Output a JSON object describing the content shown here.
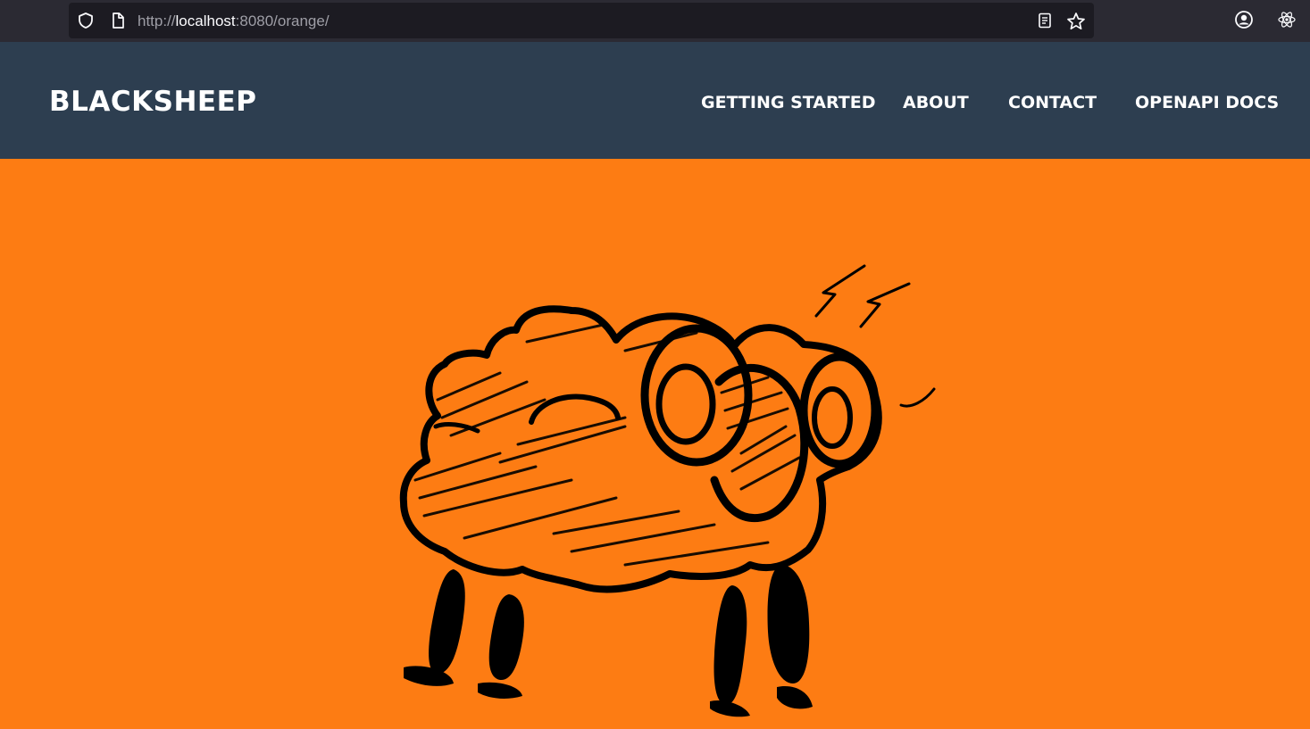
{
  "browser": {
    "url_scheme": "http://",
    "url_host": "localhost",
    "url_rest": ":8080/orange/",
    "icons": [
      "shield-icon",
      "page-icon",
      "reader-view-icon",
      "bookmark-star-icon",
      "account-icon",
      "react-devtools-icon"
    ]
  },
  "header": {
    "brand": "BLACKSHEEP",
    "nav": [
      {
        "label": "GETTING STARTED"
      },
      {
        "label": "ABOUT"
      },
      {
        "label": "CONTACT"
      },
      {
        "label": "OPENAPI DOCS"
      }
    ]
  },
  "hero": {
    "image": "black-sheep-sketch",
    "background_color": "#fd7c13"
  },
  "colors": {
    "header_bg": "#2d3e50",
    "accent": "#fd7c13",
    "browser_bg": "#2b2a33"
  }
}
